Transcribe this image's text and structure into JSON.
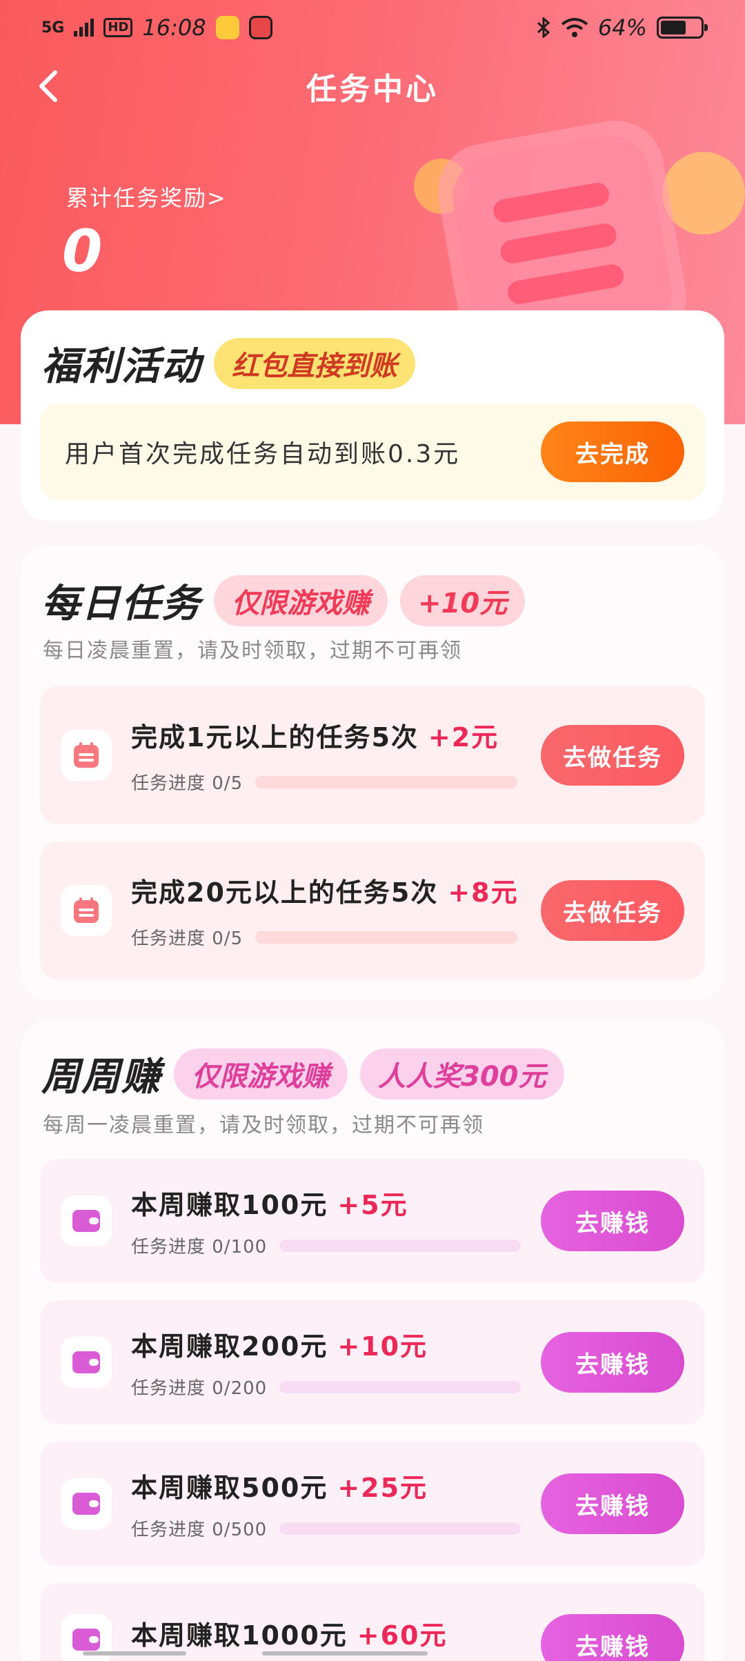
{
  "status_bar": {
    "network": "5G",
    "hd": "HD",
    "time": "16:08",
    "battery": "64%",
    "battery_level": 0.64
  },
  "nav": {
    "title": "任务中心"
  },
  "hero": {
    "reward_label": "累计任务奖励>",
    "reward_value": "0"
  },
  "welfare": {
    "title": "福利活动",
    "tag": "红包直接到账",
    "task_text": "用户首次完成任务自动到账0.3元",
    "button": "去完成"
  },
  "daily": {
    "title": "每日任务",
    "tag1": "仅限游戏赚",
    "tag2": "+10元",
    "subtitle": "每日凌晨重置，请及时领取，过期不可再领",
    "tasks": [
      {
        "title": "完成1元以上的任务5次",
        "bonus": "+2元",
        "progress": "任务进度 0/5",
        "progress_fraction": 0,
        "button": "去做任务"
      },
      {
        "title": "完成20元以上的任务5次",
        "bonus": "+8元",
        "progress": "任务进度 0/5",
        "progress_fraction": 0,
        "button": "去做任务"
      }
    ]
  },
  "weekly": {
    "title": "周周赚",
    "tag1": "仅限游戏赚",
    "tag2": "人人奖300元",
    "subtitle": "每周一凌晨重置，请及时领取，过期不可再领",
    "tasks": [
      {
        "title": "本周赚取100元",
        "bonus": "+5元",
        "progress": "任务进度 0/100",
        "progress_fraction": 0,
        "button": "去赚钱"
      },
      {
        "title": "本周赚取200元",
        "bonus": "+10元",
        "progress": "任务进度 0/200",
        "progress_fraction": 0,
        "button": "去赚钱"
      },
      {
        "title": "本周赚取500元",
        "bonus": "+25元",
        "progress": "任务进度 0/500",
        "progress_fraction": 0,
        "button": "去赚钱"
      },
      {
        "title": "本周赚取1000元",
        "bonus": "+60元",
        "progress": "",
        "progress_fraction": 0,
        "button": "去赚钱"
      }
    ]
  },
  "colors": {
    "hero_start": "#fb5a5c",
    "accent_red": "#ec2858",
    "button_orange": "#fc6204",
    "button_red": "#fd5a61",
    "button_purple": "#d94ccf"
  },
  "icons": {
    "back": "chevron-left-icon",
    "calendar": "calendar-icon",
    "wallet": "wallet-icon"
  }
}
